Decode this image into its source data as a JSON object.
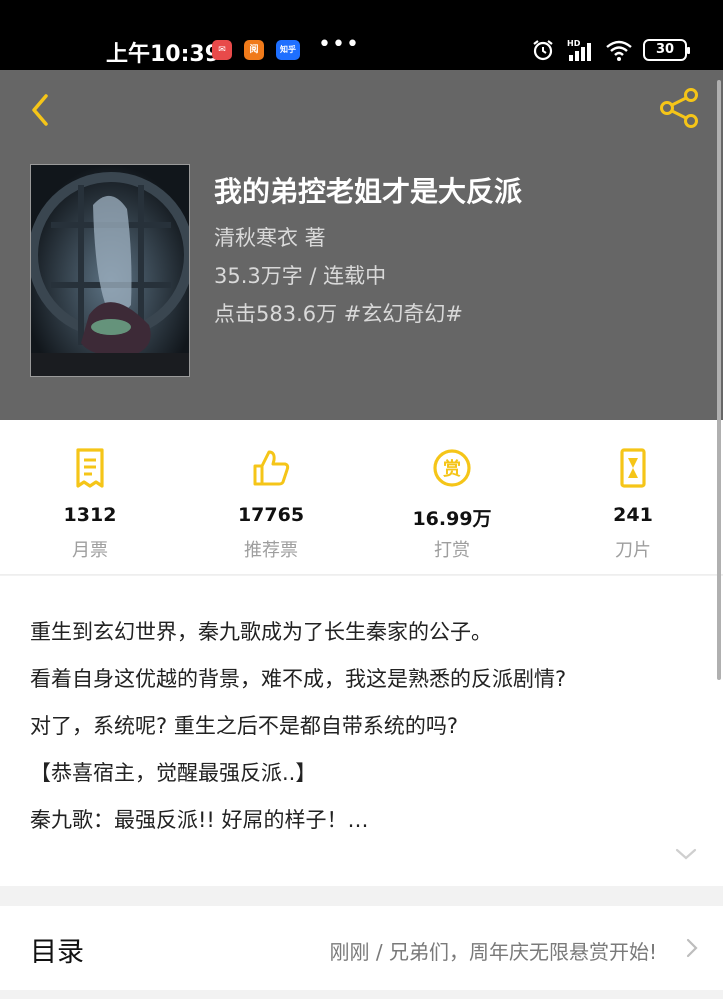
{
  "status_bar": {
    "time": "上午10:39",
    "apps": [
      {
        "icon": "mail-app-icon",
        "text": "✉",
        "color": "#e84a4a"
      },
      {
        "icon": "reader-app-icon",
        "text": "阅",
        "color": "#f07a1a"
      },
      {
        "icon": "zhihu-app-icon",
        "text": "知乎",
        "color": "#1e6fff"
      }
    ],
    "more": "•••",
    "battery": "30"
  },
  "header": {
    "title": "我的弟控老姐才是大反派",
    "author": "清秋寒衣  著",
    "words_status": "35.3万字 / 连载中",
    "clicks_genre": "点击583.6万  #玄幻奇幻#"
  },
  "stats": [
    {
      "value": "1312",
      "label": "月票",
      "icon": "monthly-ticket-icon"
    },
    {
      "value": "17765",
      "label": "推荐票",
      "icon": "thumbs-up-icon"
    },
    {
      "value": "16.99万",
      "label": "打赏",
      "icon": "reward-coin-icon"
    },
    {
      "value": "241",
      "label": "刀片",
      "icon": "blade-icon"
    }
  ],
  "synopsis": {
    "lines": [
      "重生到玄幻世界，秦九歌成为了长生秦家的公子。",
      "看着自身这优越的背景，难不成，我这是熟悉的反派剧情?",
      "对了，系统呢? 重生之后不是都自带系统的吗?",
      "【恭喜宿主，觉醒最强反派..】",
      "秦九歌：最强反派!! 好屌的样子！…"
    ]
  },
  "catalog": {
    "title": "目录",
    "latest": "刚刚 / 兄弟们，周年庆无限悬赏开始!"
  },
  "colors": {
    "accent": "#f5c518",
    "header_bg": "#666666"
  }
}
